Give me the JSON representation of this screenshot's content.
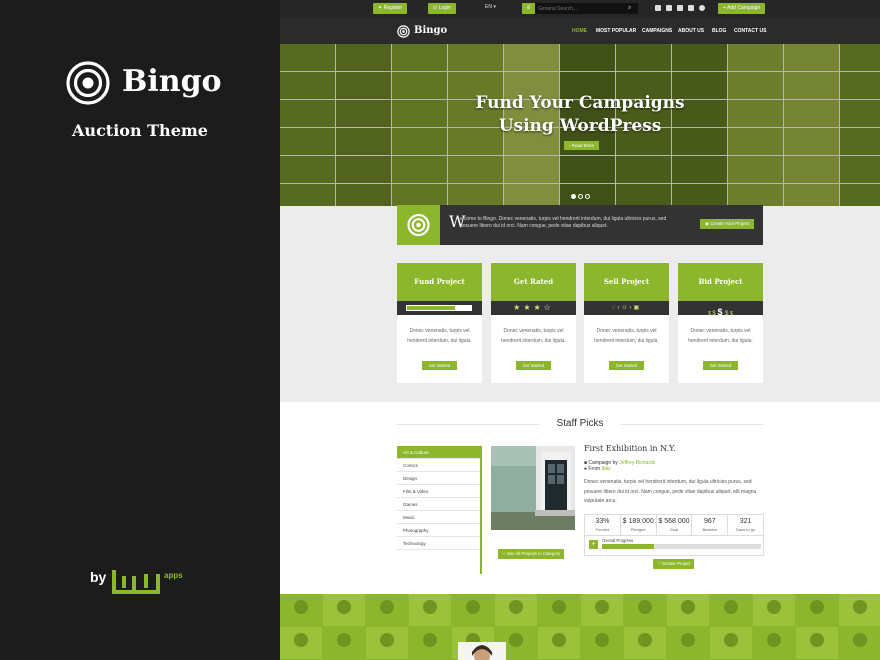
{
  "promo": {
    "brand": "Bingo",
    "subtitle": "Auction Theme",
    "by_label": "by",
    "maker_apps": "apps"
  },
  "topbar": {
    "register": "Register",
    "login": "Login",
    "language": "EN",
    "search_placeholder": "General Search...",
    "add_campaign": "Add Campaign",
    "social_icons": [
      "facebook-icon",
      "twitter-icon",
      "vimeo-icon",
      "youtube-icon",
      "pinterest-icon"
    ]
  },
  "nav": {
    "brand": "Bingo",
    "items": [
      "HOME",
      "MOST POPULAR",
      "CAMPAIGNS",
      "ABOUT US",
      "BLOG",
      "CONTACT US"
    ],
    "active_index": 0
  },
  "hero": {
    "title_line1": "Fund Your Campaigns",
    "title_line2": "Using WordPress",
    "button": "Read More",
    "slides": 3,
    "active_slide": 0
  },
  "welcome": {
    "dropcap": "W",
    "text": "elcome to Bingo. Donec venenatis, turpis vel hendrerit interdum, dui ligula ultricies purus, sed posuere libero dui id orci. Nam congue, pede vitae dapibus aliquet.",
    "button": "Create Your Project"
  },
  "cards": [
    {
      "title": "Fund Project",
      "text": "Donec venenatis, turpis vel hendrerit interdum, dui ligula.",
      "button": "Get Started",
      "progress": 0.75
    },
    {
      "title": "Get Rated",
      "text": "Donec venenatis, turpis vel hendrerit interdum, dui ligula.",
      "button": "Get Started",
      "stars": 3
    },
    {
      "title": "Sell Project",
      "text": "Donec venenatis, turpis vel hendrerit interdum, dui ligula.",
      "button": "Get Started"
    },
    {
      "title": "Bid Project",
      "text": "Donec venenatis, turpis vel hendrerit interdum, dui ligula.",
      "button": "Get Started",
      "dollars": "$ $ $ $ $"
    }
  ],
  "staff_picks": {
    "title": "Staff Picks",
    "categories": [
      "Art & Culture",
      "Comics",
      "Design",
      "Film & Video",
      "Games",
      "Music",
      "Photography",
      "Technology"
    ],
    "active_category": 0,
    "see_all": "See All Projects in Category",
    "project": {
      "title": "First Exhibition in N.Y.",
      "campaign_label": "Campaign by",
      "campaign_by": "Jeffrey Richards",
      "from_label": "From",
      "from": "Italy",
      "description": "Donec venenatis, turpis vel hendrerit interdum, dui ligula ultricies purus, sed posuere libero dui id orci. Nam congue, pede vitae dapibus aliquet, elit magna vulputate arcu.",
      "stats": [
        {
          "value": "33%",
          "label": "Funded"
        },
        {
          "value": "$ 189 000",
          "label": "Pledged"
        },
        {
          "value": "$ 568 000",
          "label": "Goal"
        },
        {
          "value": "967",
          "label": "Backers"
        },
        {
          "value": "321",
          "label": "Days to go"
        }
      ],
      "progress_label": "Overall Progress",
      "progress": 0.33,
      "donate": "Donate Project"
    }
  },
  "colors": {
    "accent": "#8cb62c",
    "dark": "#2b2b2b",
    "panel": "#1c1c1c"
  }
}
